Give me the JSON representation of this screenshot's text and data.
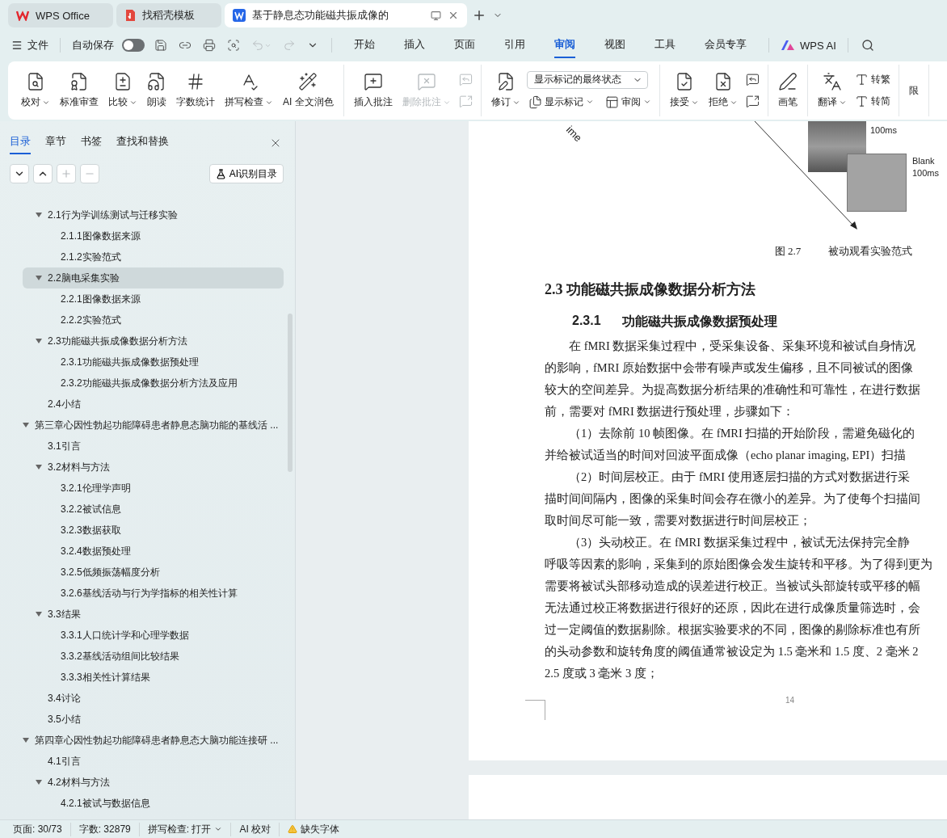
{
  "tab_bar": {
    "tabs": [
      {
        "kind": "home",
        "label": "WPS Office",
        "selected": false
      },
      {
        "kind": "template",
        "label": "找稻壳模板",
        "selected": false
      },
      {
        "kind": "document",
        "label": "基于静息态功能磁共振成像的",
        "selected": true
      }
    ]
  },
  "menu_bar": {
    "file": "文件",
    "autosave": {
      "label": "自动保存",
      "on": false
    },
    "tabs": [
      {
        "label": "开始",
        "selected": false
      },
      {
        "label": "插入",
        "selected": false
      },
      {
        "label": "页面",
        "selected": false
      },
      {
        "label": "引用",
        "selected": false
      },
      {
        "label": "审阅",
        "selected": true
      },
      {
        "label": "视图",
        "selected": false
      },
      {
        "label": "工具",
        "selected": false
      },
      {
        "label": "会员专享",
        "selected": false
      }
    ],
    "ai": "WPS AI"
  },
  "ribbon": {
    "groups": [
      {
        "items": [
          {
            "kind": "large",
            "label": "校对",
            "dropdown": true,
            "disabled": false
          },
          {
            "kind": "large",
            "label": "标准审查",
            "dropdown": false,
            "disabled": false
          },
          {
            "kind": "large",
            "label": "比较",
            "dropdown": true,
            "disabled": false
          },
          {
            "kind": "large",
            "label": "朗读",
            "dropdown": false,
            "disabled": false
          },
          {
            "kind": "large",
            "label": "字数统计",
            "dropdown": false,
            "disabled": false
          },
          {
            "kind": "large",
            "label": "拼写检查",
            "dropdown": true,
            "disabled": false
          },
          {
            "kind": "large",
            "label": "AI 全文润色",
            "dropdown": false,
            "disabled": false
          }
        ]
      },
      {
        "items": [
          {
            "kind": "large",
            "label": "插入批注",
            "dropdown": false,
            "disabled": false
          },
          {
            "kind": "large",
            "label": "删除批注",
            "dropdown": true,
            "disabled": true
          },
          {
            "kind": "stack",
            "rows": [
              [
                {
                  "kind": "small",
                  "dropdown": false,
                  "disabled": true
                }
              ],
              [
                {
                  "kind": "small",
                  "dropdown": false,
                  "disabled": true
                }
              ]
            ]
          }
        ]
      },
      {
        "items": [
          {
            "kind": "large",
            "label": "修订",
            "dropdown": true,
            "disabled": false
          },
          {
            "kind": "stack",
            "rows": [
              [
                {
                  "kind": "select",
                  "value": "显示标记的最终状态"
                }
              ],
              [
                {
                  "kind": "small",
                  "label": "显示标记",
                  "dropdown": true,
                  "disabled": false
                },
                {
                  "kind": "small",
                  "label": "审阅",
                  "dropdown": true,
                  "disabled": false
                }
              ]
            ]
          }
        ]
      },
      {
        "items": [
          {
            "kind": "large",
            "label": "接受",
            "dropdown": true,
            "disabled": false
          },
          {
            "kind": "large",
            "label": "拒绝",
            "dropdown": true,
            "disabled": false
          },
          {
            "kind": "stack",
            "rows": [
              [
                {
                  "kind": "small",
                  "dropdown": false,
                  "disabled": false
                }
              ],
              [
                {
                  "kind": "small",
                  "dropdown": false,
                  "disabled": false
                }
              ]
            ]
          }
        ]
      },
      {
        "items": [
          {
            "kind": "large",
            "label": "画笔",
            "dropdown": false,
            "disabled": false
          }
        ]
      },
      {
        "items": [
          {
            "kind": "large",
            "label": "翻译",
            "dropdown": true,
            "disabled": false
          },
          {
            "kind": "stack",
            "rows": [
              [
                {
                  "kind": "small",
                  "label": "转繁",
                  "dropdown": false,
                  "disabled": false
                }
              ],
              [
                {
                  "kind": "small",
                  "label": "转简",
                  "dropdown": false,
                  "disabled": false
                }
              ]
            ]
          }
        ]
      },
      {
        "items": [
          {
            "kind": "large",
            "label": "限",
            "dropdown": false,
            "disabled": false
          }
        ]
      }
    ]
  },
  "nav_panel": {
    "tabs": [
      {
        "label": "目录",
        "selected": true
      },
      {
        "label": "章节",
        "selected": false
      },
      {
        "label": "书签",
        "selected": false
      },
      {
        "label": "查找和替换",
        "selected": false
      }
    ],
    "ai_button": "AI识别目录",
    "outline": [
      {
        "children": [
          {
            "label": "2.1行为学训练测试与迁移实验",
            "expanded": true,
            "selected": false,
            "children": [
              {
                "label": "2.1.1图像数据来源",
                "selected": false
              },
              {
                "label": "2.1.2实验范式",
                "selected": false
              }
            ]
          },
          {
            "label": "2.2脑电采集实验",
            "expanded": true,
            "selected": true,
            "children": [
              {
                "label": "2.2.1图像数据来源",
                "selected": false
              },
              {
                "label": "2.2.2实验范式",
                "selected": false
              }
            ]
          },
          {
            "label": "2.3功能磁共振成像数据分析方法",
            "expanded": true,
            "selected": false,
            "children": [
              {
                "label": "2.3.1功能磁共振成像数据预处理",
                "selected": false
              },
              {
                "label": "2.3.2功能磁共振成像数据分析方法及应用",
                "selected": false
              }
            ]
          },
          {
            "label": "2.4小结",
            "selected": false
          }
        ]
      },
      {
        "label": "第三章心因性勃起功能障碍患者静息态脑功能的基线活 ...",
        "expanded": true,
        "selected": false,
        "children": [
          {
            "label": "3.1引言",
            "selected": false
          },
          {
            "label": "3.2材料与方法",
            "expanded": true,
            "selected": false,
            "children": [
              {
                "label": "3.2.1伦理学声明",
                "selected": false
              },
              {
                "label": "3.2.2被试信息",
                "selected": false
              },
              {
                "label": "3.2.3数据获取",
                "selected": false
              },
              {
                "label": "3.2.4数据预处理",
                "selected": false
              },
              {
                "label": "3.2.5低频振荡幅度分析",
                "selected": false
              },
              {
                "label": "3.2.6基线活动与行为学指标的相关性计算",
                "selected": false
              }
            ]
          },
          {
            "label": "3.3结果",
            "expanded": true,
            "selected": false,
            "children": [
              {
                "label": "3.3.1人口统计学和心理学数据",
                "selected": false
              },
              {
                "label": "3.3.2基线活动组间比较结果",
                "selected": false
              },
              {
                "label": "3.3.3相关性计算结果",
                "selected": false
              }
            ]
          },
          {
            "label": "3.4讨论",
            "selected": false
          },
          {
            "label": "3.5小结",
            "selected": false
          }
        ]
      },
      {
        "label": "第四章心因性勃起功能障碍患者静息态大脑功能连接研 ...",
        "expanded": true,
        "selected": false,
        "children": [
          {
            "label": "4.1引言",
            "selected": false
          },
          {
            "label": "4.2材料与方法",
            "expanded": true,
            "selected": false,
            "children": [
              {
                "label": "4.2.1被试与数据信息",
                "selected": false
              }
            ]
          }
        ]
      }
    ]
  },
  "document": {
    "figure": {
      "axis_label": "ime",
      "image_time": "100ms",
      "blank_label": "Blank",
      "blank_time": "100ms",
      "caption_number": "图 2.7",
      "caption_title": "被动观看实验范式"
    },
    "heading": "2.3 功能磁共振成像数据分析方法",
    "subheading": {
      "number": "2.3.1",
      "title": "功能磁共振成像数据预处理"
    },
    "paragraphs": [
      {
        "lines": [
          "在 fMRI 数据采集过程中，受采集设备、采集环境和被试自身情况",
          "的影响，fMRI 原始数据中会带有噪声或发生偏移，且不同被试的图像",
          "较大的空间差异。为提高数据分析结果的准确性和可靠性，在进行数据",
          "前，需要对 fMRI 数据进行预处理，步骤如下："
        ]
      },
      {
        "lines": [
          "（1）去除前 10 帧图像。在 fMRI 扫描的开始阶段，需避免磁化的",
          "并给被试适当的时间对回波平面成像（echo planar imaging, EPI）扫描"
        ]
      },
      {
        "lines": [
          "（2）时间层校正。由于 fMRI 使用逐层扫描的方式对数据进行采",
          "描时间间隔内，图像的采集时间会存在微小的差异。为了使每个扫描间",
          "取时间尽可能一致，需要对数据进行时间层校正；"
        ]
      },
      {
        "lines": [
          "（3）头动校正。在 fMRI 数据采集过程中，被试无法保持完全静",
          "呼吸等因素的影响，采集到的原始图像会发生旋转和平移。为了得到更为",
          "需要将被试头部移动造成的误差进行校正。当被试头部旋转或平移的幅",
          "无法通过校正将数据进行很好的还原，因此在进行成像质量筛选时，会",
          "过一定阈值的数据剔除。根据实验要求的不同，图像的剔除标准也有所",
          "的头动参数和旋转角度的阈值通常被设定为 1.5 毫米和 1.5 度、2 毫米 2",
          "2.5 度或 3 毫米 3 度；"
        ]
      }
    ],
    "page_number": "14"
  },
  "status_bar": {
    "items": [
      {
        "kind": "text",
        "label": "页面: 30/73"
      },
      {
        "kind": "text",
        "label": "字数: 32879"
      },
      {
        "kind": "dropdown",
        "label": "拼写检查: 打开"
      },
      {
        "kind": "text",
        "label": "AI 校对"
      },
      {
        "kind": "warning",
        "label": "缺失字体"
      }
    ]
  }
}
